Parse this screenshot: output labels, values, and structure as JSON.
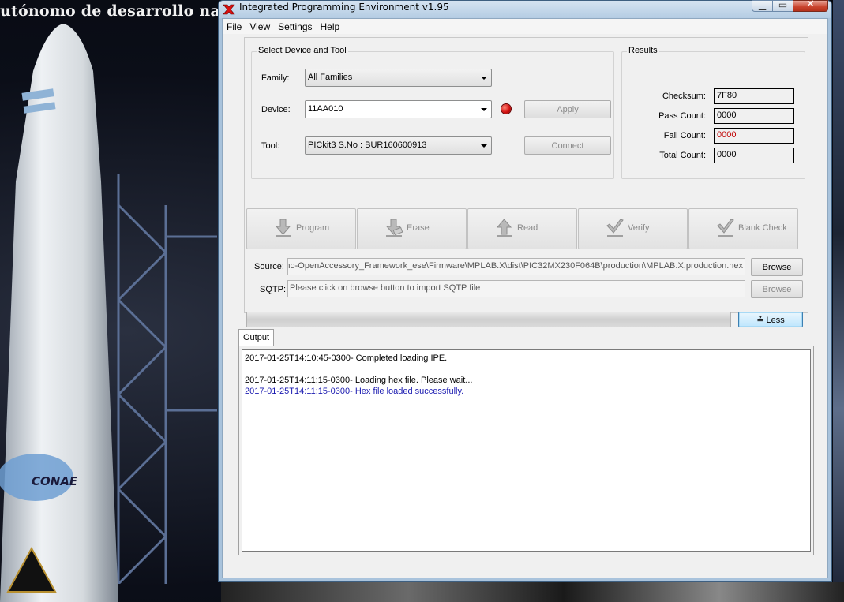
{
  "background": {
    "banner_text": "utónomo de desarrollo naci",
    "rocket_text": "CONAE"
  },
  "window": {
    "title": "Integrated Programming Environment v1.95"
  },
  "menu": [
    "File",
    "View",
    "Settings",
    "Help"
  ],
  "select": {
    "title": "Select Device and Tool",
    "family_label": "Family:",
    "family_value": "All Families",
    "device_label": "Device:",
    "device_value": "11AA010",
    "tool_label": "Tool:",
    "tool_value": "PICkit3 S.No : BUR160600913",
    "apply_label": "Apply",
    "connect_label": "Connect",
    "status_color": "#d41010"
  },
  "results": {
    "title": "Results",
    "checksum_label": "Checksum:",
    "checksum_value": "7F80",
    "pass_label": "Pass Count:",
    "pass_value": "0000",
    "fail_label": "Fail Count:",
    "fail_value": "0000",
    "total_label": "Total Count:",
    "total_value": "0000"
  },
  "operations": [
    {
      "label": "Program",
      "icon": "program-icon"
    },
    {
      "label": "Erase",
      "icon": "erase-icon"
    },
    {
      "label": "Read",
      "icon": "read-icon"
    },
    {
      "label": "Verify",
      "icon": "verify-icon"
    },
    {
      "label": "Blank Check",
      "icon": "blank-check-icon"
    }
  ],
  "source": {
    "label": "Source:",
    "value": "Demo-OpenAccessory_Framework_ese\\Firmware\\MPLAB.X\\dist\\PIC32MX230F064B\\production\\MPLAB.X.production.hex",
    "browse_label": "Browse"
  },
  "sqtp": {
    "label": "SQTP:",
    "placeholder": "Please click on browse button to import SQTP file",
    "browse_label": "Browse"
  },
  "less_label": "≛ Less",
  "output": {
    "tab_label": "Output",
    "lines": [
      {
        "text": "2017-01-25T14:10:45-0300- Completed loading IPE.",
        "color": "#000000"
      },
      {
        "text": "",
        "color": "#000000"
      },
      {
        "text": "2017-01-25T14:11:15-0300- Loading hex file. Please wait...",
        "color": "#000000"
      },
      {
        "text": "2017-01-25T14:11:15-0300- Hex file loaded successfully.",
        "color": "#1a1ab0"
      }
    ]
  }
}
